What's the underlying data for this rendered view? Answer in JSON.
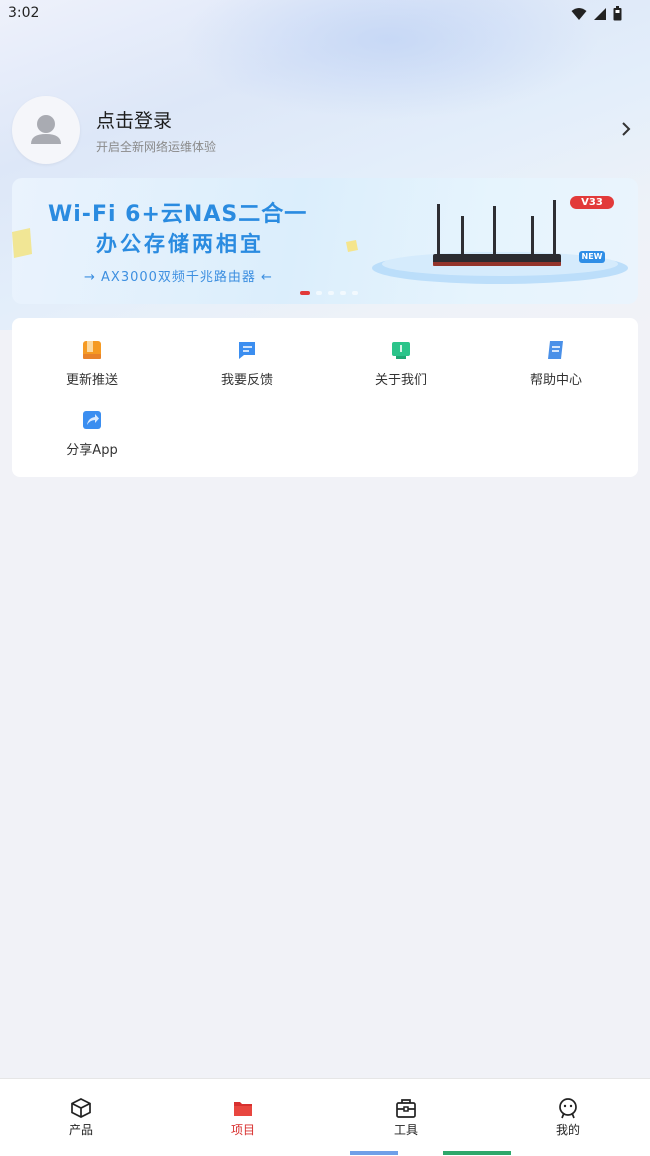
{
  "status_bar": {
    "time": "3:02",
    "icons": [
      "wifi-icon",
      "signal-icon",
      "battery-icon"
    ]
  },
  "profile": {
    "title": "点击登录",
    "subtitle": "开启全新网络运维体验",
    "avatar_icon": "user-avatar-icon"
  },
  "banner": {
    "line1": "Wi-Fi 6+云NAS二合一",
    "line2": "办公存储两相宜",
    "line3": "→ AX3000双频千兆路由器 ←",
    "badge": "V33",
    "new_badge": "NEW",
    "active_slide": 1,
    "slide_count": 5
  },
  "menu": {
    "items": [
      {
        "label": "更新推送",
        "icon": "update-push-icon",
        "color": "#f59a23"
      },
      {
        "label": "我要反馈",
        "icon": "feedback-icon",
        "color": "#3b8ef0"
      },
      {
        "label": "关于我们",
        "icon": "about-us-icon",
        "color": "#2bc48a"
      },
      {
        "label": "帮助中心",
        "icon": "help-center-icon",
        "color": "#4a90e8"
      },
      {
        "label": "分享App",
        "icon": "share-app-icon",
        "color": "#3b8ef0"
      }
    ]
  },
  "bottom_nav": {
    "items": [
      {
        "label": "产品",
        "icon": "product-cube-icon",
        "active": false
      },
      {
        "label": "项目",
        "icon": "project-folder-icon",
        "active": true
      },
      {
        "label": "工具",
        "icon": "toolbox-icon",
        "active": false
      },
      {
        "label": "我的",
        "icon": "profile-face-icon",
        "active": false
      }
    ]
  },
  "colors": {
    "accent": "#d8302f",
    "banner_text": "#2a8be0",
    "background": "#f1f2f7"
  }
}
